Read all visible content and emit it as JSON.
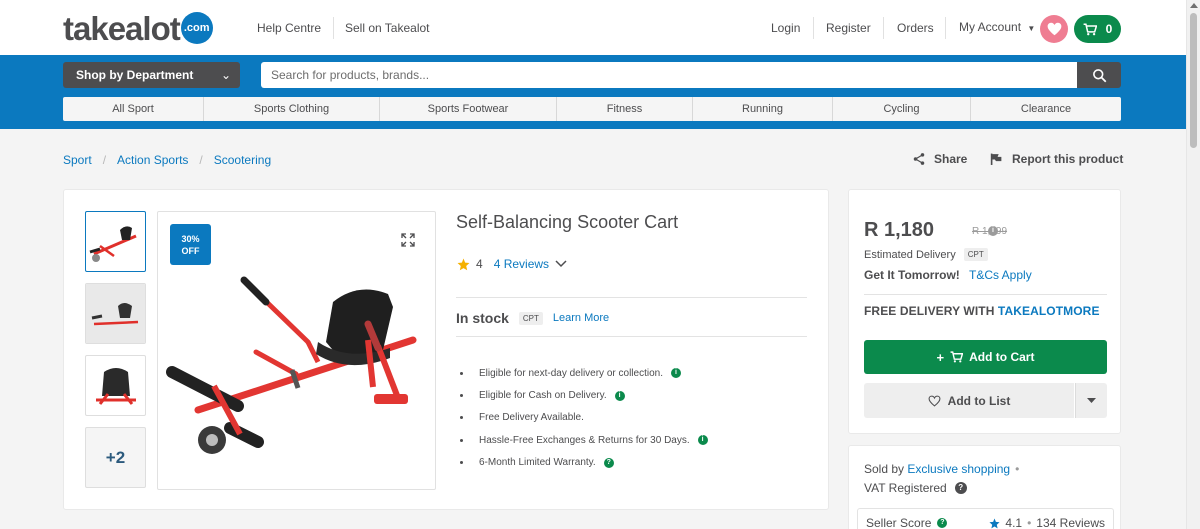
{
  "header": {
    "logo_text": "takealot",
    "logo_badge": ".com",
    "help_centre": "Help Centre",
    "sell_on": "Sell on Takealot",
    "login": "Login",
    "register": "Register",
    "orders": "Orders",
    "my_account": "My Account",
    "cart_count": "0"
  },
  "nav": {
    "department_button": "Shop by Department",
    "search_placeholder": "Search for products, brands...",
    "categories": [
      "All Sport",
      "Sports Clothing",
      "Sports Footwear",
      "Fitness",
      "Running",
      "Cycling",
      "Clearance"
    ]
  },
  "breadcrumb": {
    "items": [
      "Sport",
      "Action Sports",
      "Scootering"
    ],
    "separator": "/",
    "share": "Share",
    "report": "Report this product"
  },
  "product": {
    "discount_line1": "30%",
    "discount_line2": "OFF",
    "more_images": "+2",
    "title": "Self-Balancing Scooter Cart",
    "rating": "4",
    "reviews": "4 Reviews",
    "stock_status": "In stock",
    "stock_tag": "CPT",
    "learn_more": "Learn More",
    "bullets": [
      "Eligible for next-day delivery or collection.",
      "Eligible for Cash on Delivery.",
      "Free Delivery Available.",
      "Hassle-Free Exchanges & Returns for 30 Days.",
      "6-Month Limited Warranty."
    ],
    "bullet_info_icon": [
      true,
      true,
      false,
      true,
      true
    ]
  },
  "purchase": {
    "price": "R 1,180",
    "old_price": "R 1,699",
    "estimated_delivery": "Estimated Delivery",
    "delivery_tag": "CPT",
    "get_it": "Get It Tomorrow!",
    "tcs": "T&Cs Apply",
    "free_delivery_prefix": "FREE DELIVERY WITH ",
    "free_delivery_brand": "TAKEALOTMORE",
    "add_to_cart": "Add to Cart",
    "add_to_list": "Add to List"
  },
  "seller": {
    "sold_by_prefix": "Sold by ",
    "seller_name": "Exclusive shopping",
    "vat": "VAT Registered",
    "score_label": "Seller Score",
    "score_value": "4.1",
    "score_reviews": "134 Reviews"
  },
  "colors": {
    "brand_blue": "#0b79bf",
    "cart_green": "#0b8a4c",
    "heart_pink": "#ef7d92",
    "text_dark": "#4d4d4f"
  },
  "icons": {
    "heart": "heart-icon",
    "cart": "cart-icon",
    "search": "search-icon",
    "share": "share-icon",
    "flag": "flag-icon",
    "star": "star-icon",
    "expand": "expand-icon"
  }
}
